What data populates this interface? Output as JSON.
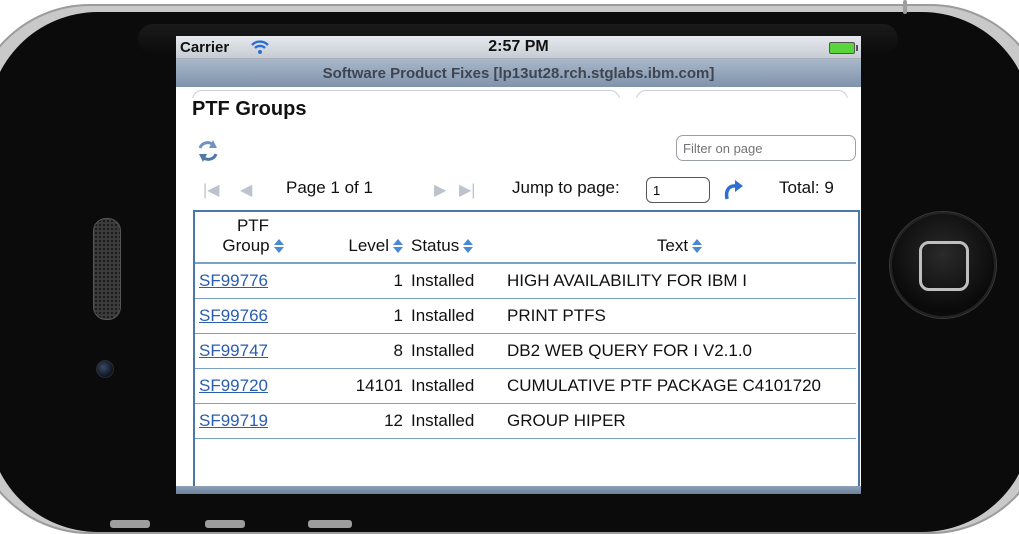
{
  "status_bar": {
    "carrier": "Carrier",
    "time": "2:57 PM"
  },
  "title_bar": {
    "title": "Software Product Fixes [lp13ut28.rch.stglabs.ibm.com]"
  },
  "page": {
    "heading": "PTF Groups"
  },
  "filter": {
    "placeholder": "Filter on page"
  },
  "pager": {
    "page_label": "Page 1 of 1",
    "jump_label": "Jump to page:",
    "jump_value": "1",
    "total_label": "Total: 9"
  },
  "table": {
    "headers": {
      "group_line1": "PTF",
      "group_line2": "Group",
      "level": "Level",
      "status": "Status",
      "text": "Text"
    },
    "rows": [
      {
        "group": "SF99776",
        "level": "1",
        "status": "Installed",
        "text": "HIGH AVAILABILITY FOR IBM I"
      },
      {
        "group": "SF99766",
        "level": "1",
        "status": "Installed",
        "text": "PRINT PTFS"
      },
      {
        "group": "SF99747",
        "level": "8",
        "status": "Installed",
        "text": "DB2 WEB QUERY FOR I V2.1.0"
      },
      {
        "group": "SF99720",
        "level": "14101",
        "status": "Installed",
        "text": "CUMULATIVE PTF PACKAGE C4101720"
      },
      {
        "group": "SF99719",
        "level": "12",
        "status": "Installed",
        "text": "GROUP HIPER"
      }
    ]
  },
  "colors": {
    "accent": "#4a76a8",
    "link": "#2a5db0",
    "title_bar": "#8fa1b8"
  }
}
